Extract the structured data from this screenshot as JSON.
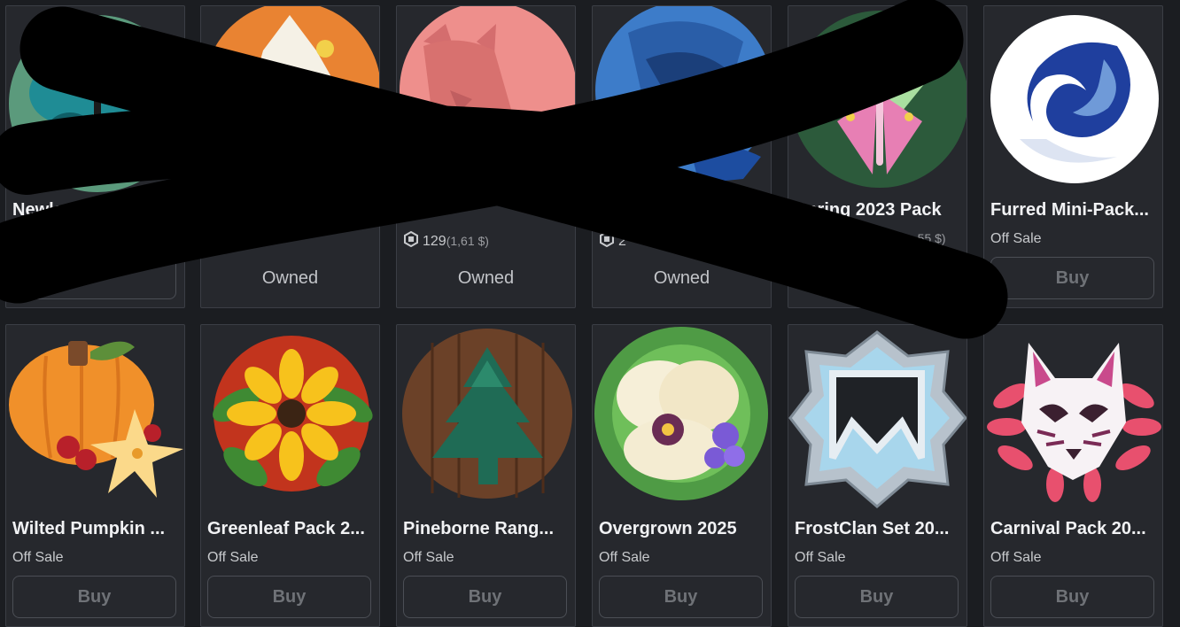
{
  "items": [
    {
      "name": "Newleaf",
      "status": "",
      "action": "",
      "art": "butterfly-badge"
    },
    {
      "name": "",
      "status": "",
      "action": "Owned",
      "art": "white-cat-badge"
    },
    {
      "name": "",
      "price": "129",
      "price_sub": "(1,61 $)",
      "action": "Owned",
      "art": "pink-cat-badge"
    },
    {
      "name": "",
      "price": "2",
      "price_sub": "",
      "action": "Owned",
      "art": "blue-creature-badge"
    },
    {
      "name": "Spring 2023 Pack",
      "status": "",
      "price_sub": "(…55 $)",
      "action": "",
      "art": "luna-moth-badge"
    },
    {
      "name": "Furred Mini-Pack...",
      "status": "Off Sale",
      "action": "Buy",
      "art": "swirl-wind-badge"
    },
    {
      "name": "Wilted Pumpkin ...",
      "status": "Off Sale",
      "action": "Buy",
      "art": "pumpkin-flower-badge"
    },
    {
      "name": "Greenleaf Pack 2...",
      "status": "Off Sale",
      "action": "Buy",
      "art": "sunflower-badge"
    },
    {
      "name": "Pineborne Rang...",
      "status": "Off Sale",
      "action": "Buy",
      "art": "pine-tree-badge"
    },
    {
      "name": "Overgrown 2025",
      "status": "Off Sale",
      "action": "Buy",
      "art": "pansy-lilypad-badge"
    },
    {
      "name": "FrostClan Set 20...",
      "status": "Off Sale",
      "action": "Buy",
      "art": "frost-emblem-badge"
    },
    {
      "name": "Carnival Pack 20...",
      "status": "Off Sale",
      "action": "Buy",
      "art": "fox-mask-badge"
    }
  ],
  "colors": {
    "background": "#1b1d21",
    "card": "#26282d",
    "border": "#3b3e45",
    "scribble": "#000000"
  }
}
